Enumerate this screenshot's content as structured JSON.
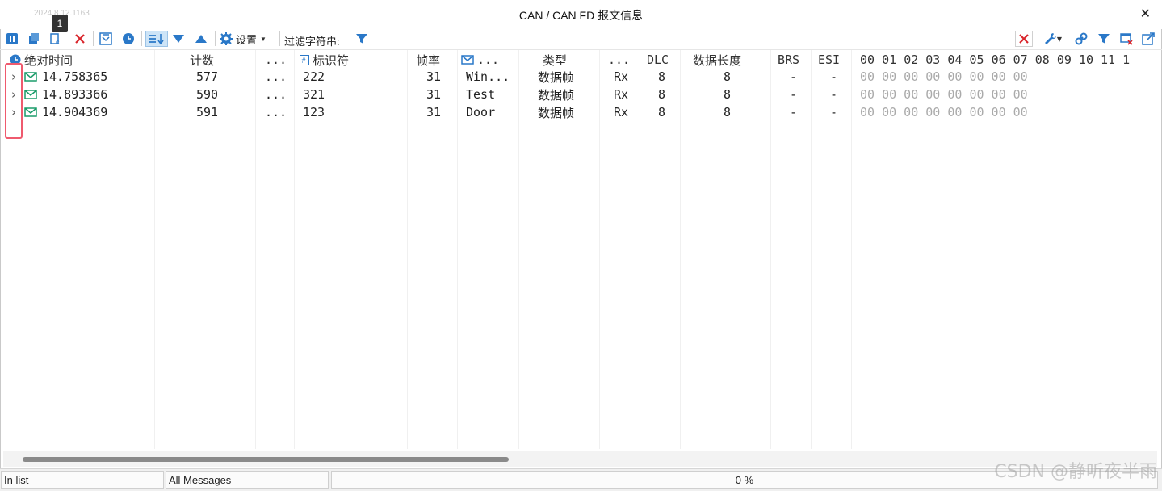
{
  "window": {
    "stamp": "2024.8.12.1163",
    "title": "CAN / CAN FD 报文信息",
    "badge": "1",
    "close": "✕"
  },
  "toolbar": {
    "settings_label": "设置",
    "filter_label": "过滤字符串:"
  },
  "colors": {
    "accent": "#2a78c8",
    "msg_icon": "#1a9c6a",
    "highlight": "#ef5a6e",
    "close_red": "#d9262c"
  },
  "columns": {
    "abs_time": "绝对时间",
    "count": "计数",
    "more1": "...",
    "id": "标识符",
    "rate": "帧率",
    "name": "...",
    "type": "类型",
    "more2": "...",
    "dlc": "DLC",
    "data_len": "数据长度",
    "brs": "BRS",
    "esi": "ESI",
    "bytes": [
      "00",
      "01",
      "02",
      "03",
      "04",
      "05",
      "06",
      "07",
      "08",
      "09",
      "10",
      "11",
      "1"
    ]
  },
  "rows": [
    {
      "time": "14.758365",
      "count": "577",
      "more": "...",
      "id": "222",
      "rate": "31",
      "name": "Win...",
      "type": "数据帧",
      "dir": "Rx",
      "dlc": "8",
      "len": "8",
      "brs": "-",
      "esi": "-",
      "data": "00 00 00 00 00 00 00 00"
    },
    {
      "time": "14.893366",
      "count": "590",
      "more": "...",
      "id": "321",
      "rate": "31",
      "name": "Test",
      "type": "数据帧",
      "dir": "Rx",
      "dlc": "8",
      "len": "8",
      "brs": "-",
      "esi": "-",
      "data": "00 00 00 00 00 00 00 00"
    },
    {
      "time": "14.904369",
      "count": "591",
      "more": "...",
      "id": "123",
      "rate": "31",
      "name": "Door",
      "type": "数据帧",
      "dir": "Rx",
      "dlc": "8",
      "len": "8",
      "brs": "-",
      "esi": "-",
      "data": "00 00 00 00 00 00 00 00"
    }
  ],
  "status": {
    "in_list": "In list",
    "all_messages": "All Messages",
    "progress": "0 %"
  },
  "watermark": "CSDN @静听夜半雨"
}
